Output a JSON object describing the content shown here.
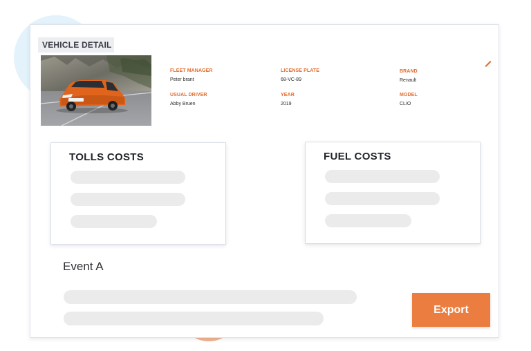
{
  "header": {
    "title": "VEHICLE DETAIL"
  },
  "vehicle": {
    "fleet_manager": {
      "label": "FLEET MANAGER",
      "value": "Peter brant"
    },
    "license_plate": {
      "label": "LICENSE PLATE",
      "value": "68-VC-89"
    },
    "brand": {
      "label": "BRAND",
      "value": "Renault"
    },
    "usual_driver": {
      "label": "USUAL DRIVER",
      "value": "Abby Bruen"
    },
    "year": {
      "label": "YEAR",
      "value": "2019"
    },
    "model": {
      "label": "MODEL",
      "value": "CLIO"
    }
  },
  "panels": {
    "tolls": {
      "title": "TOLLS COSTS"
    },
    "fuel": {
      "title": "FUEL COSTS"
    }
  },
  "event": {
    "title": "Event A"
  },
  "actions": {
    "export_label": "Export"
  },
  "colors": {
    "accent": "#ea7d3f",
    "label": "#e46c2c",
    "placeholder": "#ebebeb"
  },
  "icons": {
    "edit": "pencil-icon"
  }
}
